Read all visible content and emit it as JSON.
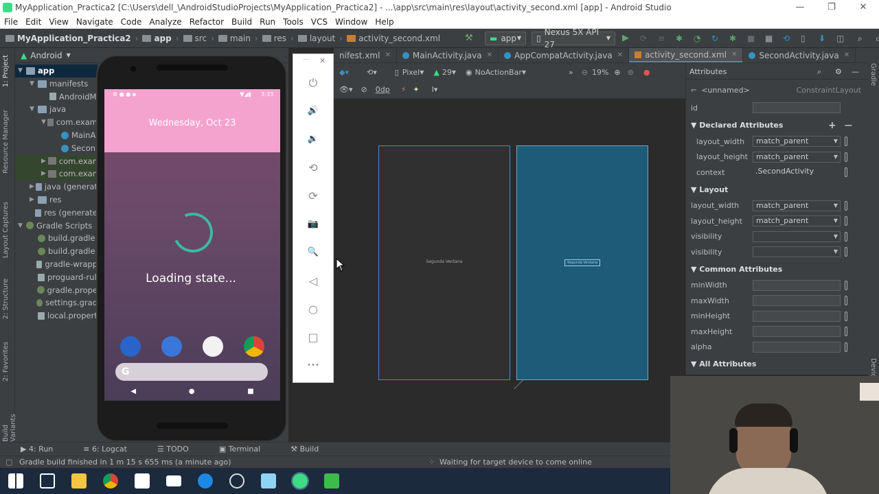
{
  "window": {
    "title": "MyApplication_Practica2 [C:\\Users\\dell_\\AndroidStudioProjects\\MyApplication_Practica2] - ...\\app\\src\\main\\res\\layout\\activity_second.xml [app] - Android Studio",
    "controls": [
      "—",
      "❐",
      "✕"
    ]
  },
  "menu": [
    "File",
    "Edit",
    "View",
    "Navigate",
    "Code",
    "Analyze",
    "Refactor",
    "Build",
    "Run",
    "Tools",
    "VCS",
    "Window",
    "Help"
  ],
  "breadcrumb": [
    "MyApplication_Practica2",
    "app",
    "src",
    "main",
    "res",
    "layout",
    "activity_second.xml"
  ],
  "toolbar": {
    "run_config": "app",
    "device": "Nexus 5X API 27"
  },
  "left_tools": [
    "1: Project",
    "Resource Manager",
    "Layout Captures",
    "2: Structure",
    "2: Favorites",
    "Build Variants"
  ],
  "project": {
    "view": "Android",
    "tree": [
      {
        "label": "app",
        "depth": 0,
        "arrow": "▼",
        "icon": "folder",
        "sel": true
      },
      {
        "label": "manifests",
        "depth": 1,
        "arrow": "▼",
        "icon": "folder"
      },
      {
        "label": "AndroidM",
        "depth": 2,
        "arrow": "",
        "icon": "file"
      },
      {
        "label": "java",
        "depth": 1,
        "arrow": "▼",
        "icon": "folder"
      },
      {
        "label": "com.exam",
        "depth": 2,
        "arrow": "▼",
        "icon": "pkg"
      },
      {
        "label": "MainA",
        "depth": 3,
        "arrow": "",
        "icon": "cls"
      },
      {
        "label": "Secon",
        "depth": 3,
        "arrow": "",
        "icon": "cls"
      },
      {
        "label": "com.exan",
        "depth": 2,
        "arrow": "▶",
        "icon": "pkg",
        "hl": true
      },
      {
        "label": "com.exan",
        "depth": 2,
        "arrow": "▶",
        "icon": "pkg",
        "hl": true
      },
      {
        "label": "java (generat",
        "depth": 1,
        "arrow": "▶",
        "icon": "folder"
      },
      {
        "label": "res",
        "depth": 1,
        "arrow": "▶",
        "icon": "folder"
      },
      {
        "label": "res (generate",
        "depth": 1,
        "arrow": "",
        "icon": "folder"
      },
      {
        "label": "Gradle Scripts",
        "depth": 0,
        "arrow": "▼",
        "icon": "gradle"
      },
      {
        "label": "build.gradle",
        "depth": 1,
        "arrow": "",
        "icon": "gradle"
      },
      {
        "label": "build.gradle",
        "depth": 1,
        "arrow": "",
        "icon": "gradle"
      },
      {
        "label": "gradle-wrapp",
        "depth": 1,
        "arrow": "",
        "icon": "file"
      },
      {
        "label": "proguard-rul",
        "depth": 1,
        "arrow": "",
        "icon": "file"
      },
      {
        "label": "gradle.prope",
        "depth": 1,
        "arrow": "",
        "icon": "gradle"
      },
      {
        "label": "settings.grad",
        "depth": 1,
        "arrow": "",
        "icon": "gradle"
      },
      {
        "label": "local.propert",
        "depth": 1,
        "arrow": "",
        "icon": "file"
      }
    ]
  },
  "emulator": {
    "status_time": "3:33",
    "date": "Wednesday, Oct 23",
    "loading": "Loading state...",
    "search_glyph": "G",
    "nav": [
      "◀",
      "●",
      "■"
    ],
    "side_buttons": [
      "power-icon",
      "volume-up-icon",
      "volume-down-icon",
      "rotate-left-icon",
      "rotate-right-icon",
      "camera-icon",
      "zoom-icon",
      "back-icon",
      "home-icon",
      "overview-icon",
      "more-icon"
    ],
    "side_glyphs": [
      "⏻",
      "🔊",
      "🔉",
      "⟲",
      "⟳",
      "📷",
      "🔍",
      "◁",
      "○",
      "□",
      "•••"
    ],
    "close": "✕",
    "minimize": "—"
  },
  "editor_tabs": [
    {
      "label": "nifest.xml",
      "active": false
    },
    {
      "label": "MainActivity.java",
      "active": false
    },
    {
      "label": "AppCompatActivity.java",
      "active": false
    },
    {
      "label": "activity_second.xml",
      "active": true
    },
    {
      "label": "SecondActivity.java",
      "active": false
    }
  ],
  "design_toolbar": {
    "device": "Pixel",
    "api": "29",
    "theme": "NoActionBar",
    "zoom": "19%",
    "margin": "0dp"
  },
  "design": {
    "label": "Segunda Ventana",
    "blueprint_label": "Segunda Ventana"
  },
  "attributes": {
    "title": "Attributes",
    "component": "<unnamed>",
    "component_type": "ConstraintLayout",
    "id_label": "id",
    "sections": [
      {
        "name": "Declared Attributes",
        "rows": [
          {
            "k": "layout_width",
            "v": "match_parent",
            "dd": true
          },
          {
            "k": "layout_height",
            "v": "match_parent",
            "dd": true
          },
          {
            "k": "context",
            "v": ".SecondActivity",
            "dd": false,
            "plain": true
          }
        ]
      },
      {
        "name": "Layout",
        "rows": [
          {
            "k": "layout_width",
            "v": "match_parent",
            "dd": true
          },
          {
            "k": "layout_height",
            "v": "match_parent",
            "dd": true
          },
          {
            "k": "visibility",
            "v": "",
            "dd": true
          },
          {
            "k": "visibility",
            "v": "",
            "dd": true
          }
        ]
      },
      {
        "name": "Common Attributes",
        "rows": [
          {
            "k": "minWidth",
            "v": "",
            "dd": false
          },
          {
            "k": "maxWidth",
            "v": "",
            "dd": false
          },
          {
            "k": "minHeight",
            "v": "",
            "dd": false
          },
          {
            "k": "maxHeight",
            "v": "",
            "dd": false
          },
          {
            "k": "alpha",
            "v": "",
            "dd": false
          }
        ]
      },
      {
        "name": "All Attributes",
        "rows": []
      }
    ]
  },
  "right_tools": [
    "Gradle",
    "Device File Explorer"
  ],
  "bottom_tools": [
    "4: Run",
    "6: Logcat",
    "TODO",
    "Terminal",
    "Build"
  ],
  "status": {
    "message": "Gradle build finished in 1 m 15 s 655 ms (a minute ago)",
    "background_task": "Waiting for target device to come online"
  },
  "taskbar": [
    "windows-start-icon",
    "task-view-icon",
    "file-explorer-icon",
    "chrome-icon",
    "store-icon",
    "mail-icon",
    "edge-icon",
    "unity-icon",
    "notepad-icon",
    "android-studio-icon",
    "green-app-icon"
  ],
  "colors": {
    "accent": "#4a88c7",
    "blueprint": "#1e5b78",
    "loader": "#3eb8a0",
    "lockscreen_top": "#f4a3cf"
  }
}
